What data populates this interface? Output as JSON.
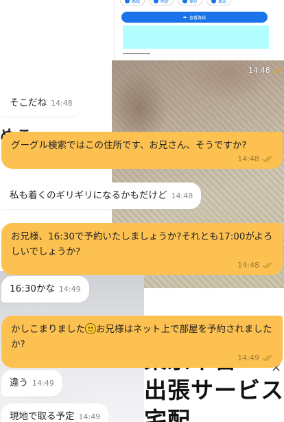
{
  "embed": {
    "chips": [
      {
        "label": "路线"
      },
      {
        "label": "附近"
      },
      {
        "label": "保存"
      },
      {
        "label": "发送"
      }
    ],
    "route_button": "查看路线"
  },
  "background_text": {
    "partial": "めこ",
    "poster_lines": [
      "東京本番",
      "出張サービス",
      "宅配"
    ]
  },
  "messages": [
    {
      "id": "m0",
      "direction": "out",
      "text": "",
      "time": "14:48",
      "read": true
    },
    {
      "id": "m1",
      "direction": "in",
      "text": "そこだね",
      "time": "14:48"
    },
    {
      "id": "m2",
      "direction": "out",
      "text": "グーグル検索ではこの住所です、お兄さん、そうですか?",
      "time": "14:48",
      "read": true
    },
    {
      "id": "m3",
      "direction": "in",
      "text": "私も着くのギリギリになるかもだけど",
      "time": "14:48"
    },
    {
      "id": "m4",
      "direction": "out",
      "text": "お兄様、16:30で予約いたしましょうか?それとも17:00がよろしいでしょうか?",
      "time": "14:48",
      "read": true
    },
    {
      "id": "m5",
      "direction": "in",
      "text": "16:30かな",
      "time": "14:49"
    },
    {
      "id": "m6",
      "direction": "out",
      "text_before": "かしこまりました",
      "text_after": "お兄様はネット上で部屋を予約されましたか?",
      "emoji": "smiling-face",
      "time": "14:49",
      "read": true
    },
    {
      "id": "m7",
      "direction": "in",
      "text": "違う",
      "time": "14:49"
    },
    {
      "id": "m8",
      "direction": "in",
      "text": "現地で取る予定",
      "time": "14:49"
    }
  ],
  "colors": {
    "outgoing_bubble": "#fdc151",
    "incoming_bubble": "#ffffff",
    "read_check": "#c8962e"
  }
}
